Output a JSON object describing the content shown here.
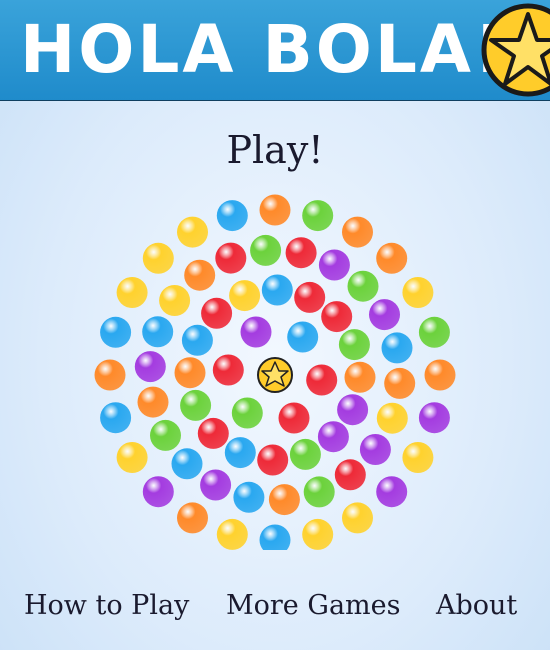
{
  "app": {
    "title": "HOLA BOLA!"
  },
  "menu": {
    "play_label": "Play!",
    "how_to_play_label": "How to Play",
    "more_games_label": "More Games",
    "about_label": "About"
  },
  "icons": {
    "logo": "star-icon",
    "center": "star-icon"
  },
  "colors": {
    "header": "#1f8bcb",
    "orange": "#ff8a2a",
    "green": "#6cd23c",
    "red": "#ee2a38",
    "yellow": "#ffd22e",
    "blue": "#2aa8f0",
    "purple": "#a43ce0",
    "star": "#ffcc2a"
  },
  "board": {
    "rings": [
      [
        "orange",
        "green",
        "orange",
        "orange",
        "yellow",
        "green",
        "orange",
        "purple",
        "yellow",
        "purple",
        "yellow",
        "yellow",
        "blue",
        "yellow",
        "orange",
        "purple",
        "yellow",
        "blue",
        "orange",
        "blue",
        "yellow",
        "yellow",
        "yellow",
        "blue"
      ],
      [
        "red",
        "purple",
        "green",
        "purple",
        "blue",
        "orange",
        "yellow",
        "purple",
        "red",
        "green",
        "orange",
        "blue",
        "purple",
        "blue",
        "green",
        "orange",
        "purple",
        "blue",
        "yellow",
        "orange",
        "red",
        "green"
      ],
      [
        "red",
        "red",
        "green",
        "orange",
        "purple",
        "purple",
        "green",
        "red",
        "blue",
        "red",
        "green",
        "orange",
        "blue",
        "red",
        "yellow",
        "blue"
      ],
      [
        "blue",
        "red",
        "red",
        "green",
        "red",
        "purple"
      ]
    ]
  }
}
